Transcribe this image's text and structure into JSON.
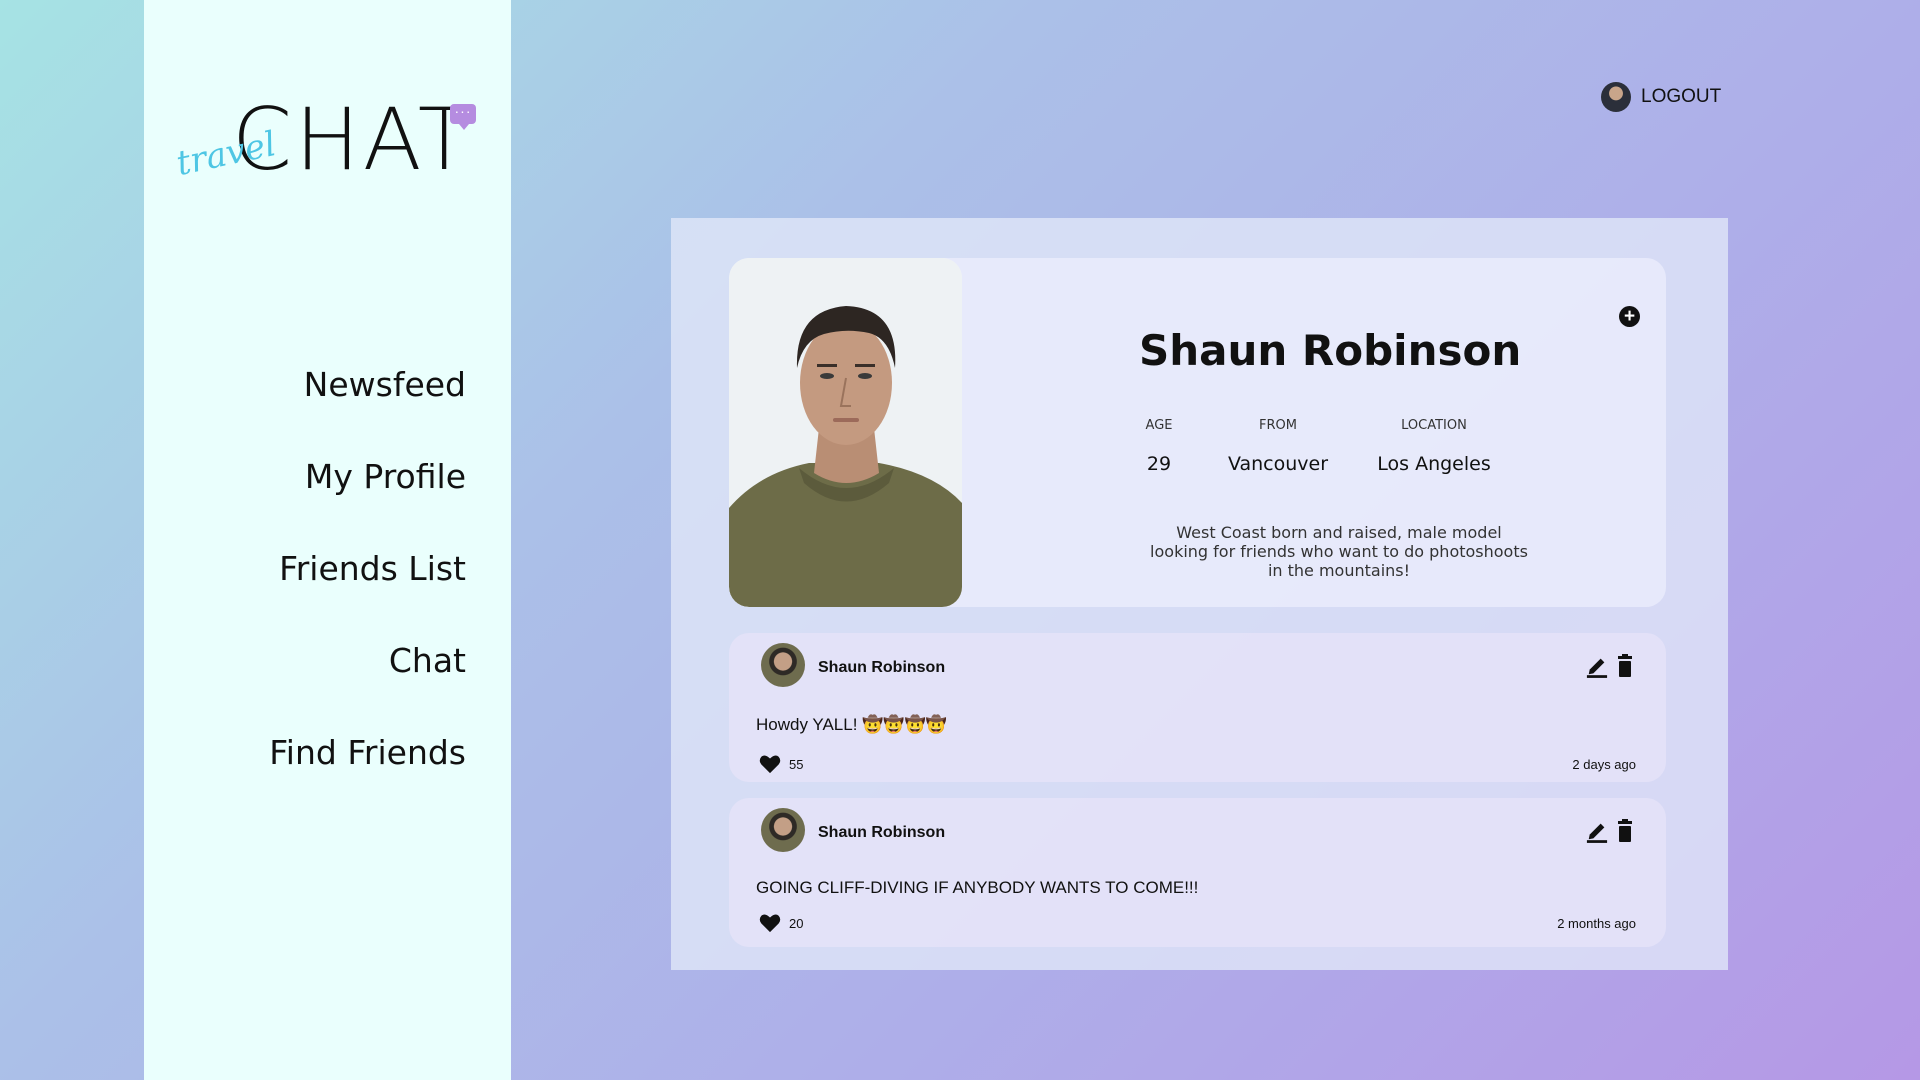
{
  "logo": {
    "main": "CHAT",
    "script": "travel",
    "bubble": "···"
  },
  "sidebar": {
    "items": [
      {
        "label": "Newsfeed"
      },
      {
        "label": "My Profile"
      },
      {
        "label": "Friends List"
      },
      {
        "label": "Chat"
      },
      {
        "label": "Find Friends"
      }
    ]
  },
  "header": {
    "logout_label": "LOGOUT"
  },
  "profile": {
    "name": "Shaun Robinson",
    "stats": [
      {
        "label": "AGE",
        "value": "29"
      },
      {
        "label": "FROM",
        "value": "Vancouver"
      },
      {
        "label": "LOCATION",
        "value": "Los Angeles"
      }
    ],
    "bio": "West Coast born and raised, male model looking for friends who want to do photoshoots in the mountains!"
  },
  "posts": [
    {
      "author": "Shaun Robinson",
      "text": "Howdy YALL! 🤠🤠🤠🤠",
      "likes": "55",
      "time": "2 days ago"
    },
    {
      "author": "Shaun Robinson",
      "text": "GOING CLIFF-DIVING IF ANYBODY WANTS TO COME!!!",
      "likes": "20",
      "time": "2 months ago"
    }
  ],
  "colors": {
    "sidebar_bg": "#eafffd",
    "logo_script": "#4ec6e4",
    "logo_bubble": "#b58ce0",
    "panel_bg": "#e1e8f8"
  },
  "icons": {
    "add": "plus-circle-icon",
    "edit": "pencil-icon",
    "delete": "trash-icon",
    "like": "heart-icon"
  }
}
